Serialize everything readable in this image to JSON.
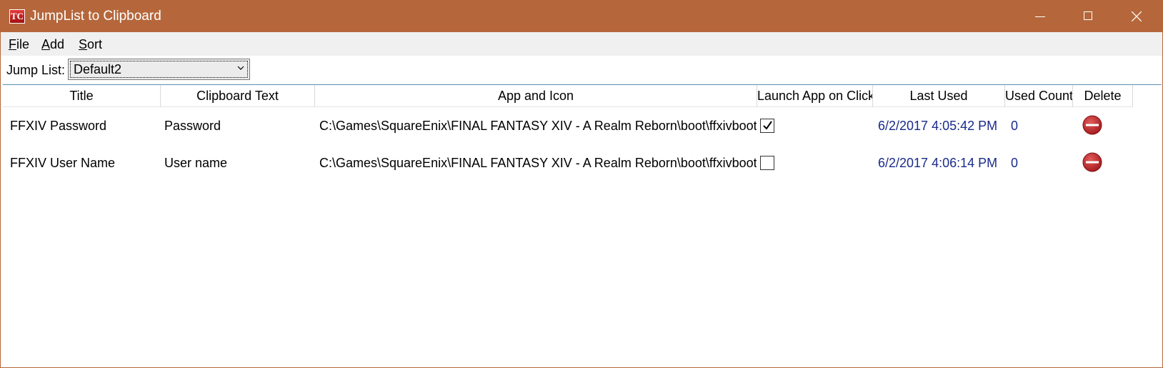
{
  "window": {
    "title": "JumpList to Clipboard",
    "app_icon_text": "TC",
    "accent_color": "#b5673b"
  },
  "menu": {
    "items": [
      {
        "label": "File",
        "access_key": "F",
        "rest": "ile"
      },
      {
        "label": "Add",
        "access_key": "A",
        "rest": "dd"
      },
      {
        "label": "Sort",
        "access_key": "S",
        "rest": "ort"
      }
    ]
  },
  "jumplist": {
    "label": "Jump List:",
    "selected": "Default2"
  },
  "grid": {
    "columns": [
      "Title",
      "Clipboard Text",
      "App and Icon",
      "Launch App on Click",
      "Last Used",
      "Used Count",
      "Delete"
    ],
    "rows": [
      {
        "title": "FFXIV Password",
        "clipboard_text": "Password",
        "app": "C:\\Games\\SquareEnix\\FINAL FANTASY XIV - A Realm Reborn\\boot\\ffxivboot.exe",
        "launch_on_click": true,
        "last_used": "6/2/2017 4:05:42 PM",
        "used_count": "0"
      },
      {
        "title": "FFXIV User Name",
        "clipboard_text": "User name",
        "app": "C:\\Games\\SquareEnix\\FINAL FANTASY XIV - A Realm Reborn\\boot\\ffxivboot.exe",
        "launch_on_click": false,
        "last_used": "6/2/2017 4:06:14 PM",
        "used_count": "0"
      }
    ]
  },
  "icons": {
    "delete": "delete-icon",
    "check": "check-icon",
    "minimize": "minimize-icon",
    "maximize": "maximize-icon",
    "close": "close-icon",
    "chevron": "chevron-down-icon"
  },
  "colors": {
    "link_blue": "#1a2b8a",
    "delete_red": "#c0282b"
  }
}
